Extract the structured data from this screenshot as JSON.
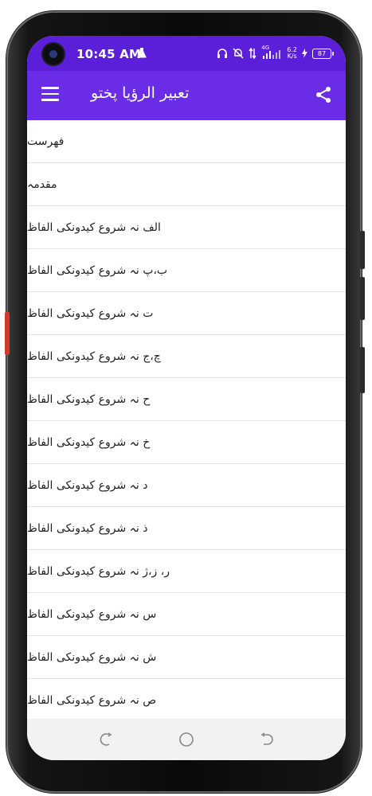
{
  "status_bar": {
    "time": "10:45 AM",
    "network_type": "4G",
    "net_speed_value": "6.2",
    "net_speed_unit": "K/s",
    "battery_level": "87",
    "icons": [
      "headphones-icon",
      "bell-off-icon",
      "data-arrows-icon",
      "signal-icon",
      "charging-icon"
    ]
  },
  "app_bar": {
    "title": "تعبیر الرؤیا پختو",
    "menu_icon": "hamburger-menu-icon",
    "share_icon": "share-icon"
  },
  "list": {
    "items": [
      "فهرست",
      "مقدمہ",
      "الف نہ شروع کیدونکی الفاظ",
      "ب،پ نہ شروع کیدونکی الفاظ",
      "ت نہ شروع کیدونکی الفاظ",
      "چ،ج نہ شروع کیدونکی الفاظ",
      "ح نہ شروع کیدونکی الفاظ",
      "خ نہ شروع کیدونکی الفاظ",
      "د نہ شروع کیدونکی الفاظ",
      "ذ نہ شروع کیدونکی الفاظ",
      "ر، ز،ژ نہ شروع کیدونکی الفاظ",
      "س نہ شروع کیدونکی الفاظ",
      "ش نہ شروع کیدونکی الفاظ",
      "ص نہ شروع کیدونکی الفاظ"
    ]
  },
  "colors": {
    "status_bar": "#5b1fd9",
    "app_bar": "#6a2ce6",
    "list_text": "#222222",
    "divider": "#e3e3e3",
    "nav_bar": "#f2f2f2"
  }
}
